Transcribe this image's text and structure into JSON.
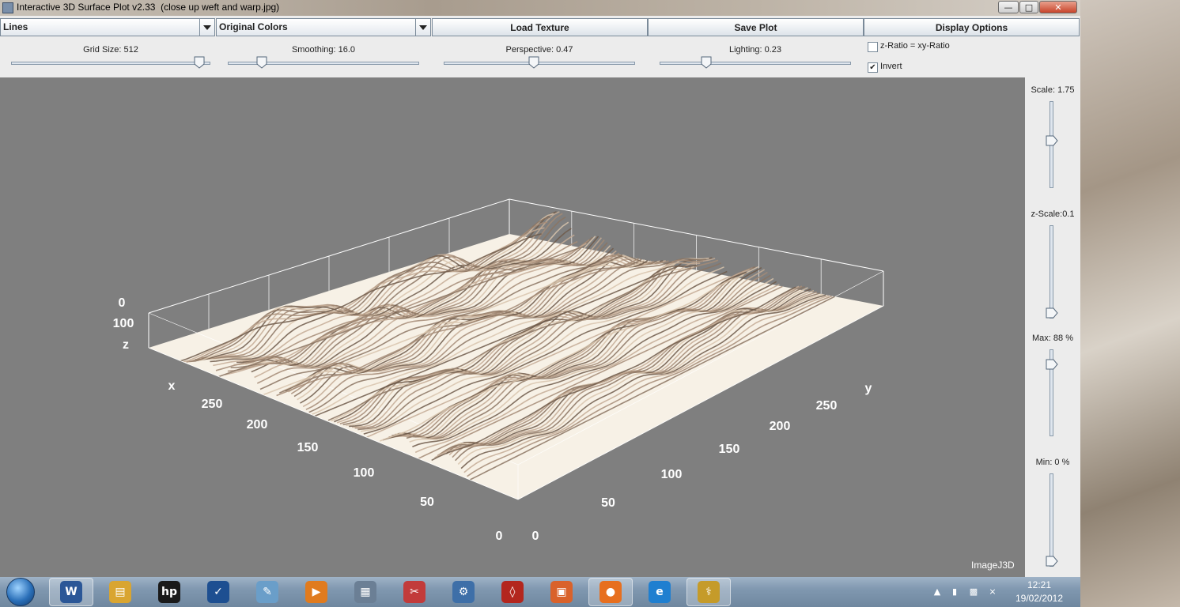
{
  "window": {
    "title": "Interactive 3D Surface Plot v2.33  (close up weft and warp.jpg)",
    "minimize_glyph": "—",
    "maximize_glyph": "□",
    "close_glyph": "✕"
  },
  "toolbar": {
    "display_mode": "Lines",
    "color_mode": "Original Colors",
    "load_texture": "Load Texture",
    "save_plot": "Save Plot",
    "display_options": "Display Options"
  },
  "sliders": {
    "grid_size": {
      "label": "Grid Size: 512",
      "fraction": 0.97
    },
    "smoothing": {
      "label": "Smoothing: 16.0",
      "fraction": 0.16
    },
    "perspective": {
      "label": "Perspective: 0.47",
      "fraction": 0.47
    },
    "lighting": {
      "label": "Lighting: 0.23",
      "fraction": 0.23
    }
  },
  "options": {
    "z_ratio": {
      "label": "z-Ratio = xy-Ratio",
      "checked": false,
      "mark": ""
    },
    "invert": {
      "label": "Invert",
      "checked": true,
      "mark": "✔"
    }
  },
  "side_sliders": {
    "scale": {
      "label": "Scale: 1.75",
      "fraction": 0.55
    },
    "z_scale": {
      "label": "z-Scale:0.1",
      "fraction": 0.0
    },
    "max": {
      "label": "Max: 88 %",
      "fraction": 0.88
    },
    "min": {
      "label": "Min: 0 %",
      "fraction": 0.0
    }
  },
  "plot": {
    "background": "#7f7f7f",
    "box_color": "#ffffff",
    "watermark": "ImageJ3D",
    "axis_labels": {
      "x": "x",
      "y": "y",
      "z": "z"
    },
    "z_ticks": [
      "0",
      "100"
    ],
    "x_ticks": [
      "250",
      "200",
      "150",
      "100",
      "50",
      "0"
    ],
    "y_ticks": [
      "250",
      "200",
      "150",
      "100",
      "50",
      "0"
    ]
  },
  "taskbar": {
    "items": [
      {
        "name": "word-icon",
        "glyph": "W",
        "color": "#2b5797"
      },
      {
        "name": "explorer-icon",
        "glyph": "▤",
        "color": "#d9a531"
      },
      {
        "name": "hp-icon",
        "glyph": "hp",
        "color": "#1a1a1a"
      },
      {
        "name": "tasks-icon",
        "glyph": "✓",
        "color": "#1d4f91"
      },
      {
        "name": "paint-icon",
        "glyph": "✎",
        "color": "#6a9ec9"
      },
      {
        "name": "media-player-icon",
        "glyph": "▶",
        "color": "#e07b1f"
      },
      {
        "name": "calculator-icon",
        "glyph": "▦",
        "color": "#6b7f95"
      },
      {
        "name": "snipping-tool-icon",
        "glyph": "✂",
        "color": "#c23b3b"
      },
      {
        "name": "network-icon",
        "glyph": "⚙",
        "color": "#3e6fa8"
      },
      {
        "name": "acrobat-icon",
        "glyph": "◊",
        "color": "#b3261e"
      },
      {
        "name": "office-icon",
        "glyph": "▣",
        "color": "#d9622b"
      },
      {
        "name": "firefox-icon",
        "glyph": "●",
        "color": "#e76f1f"
      },
      {
        "name": "internet-explorer-icon",
        "glyph": "e",
        "color": "#1f7fd0"
      },
      {
        "name": "imagej-icon",
        "glyph": "⚕",
        "color": "#c59b2a"
      }
    ],
    "clock_time": "12:21",
    "clock_date": "19/02/2012"
  }
}
